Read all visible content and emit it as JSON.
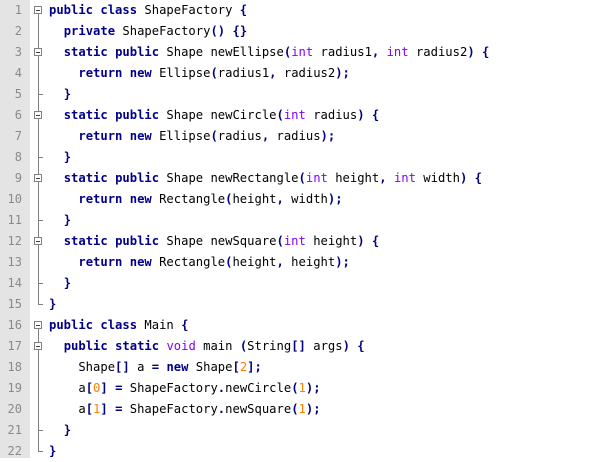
{
  "editor": {
    "lines": [
      {
        "num": "1",
        "tokens": [
          {
            "t": "public",
            "c": "kw"
          },
          {
            "t": " "
          },
          {
            "t": "class",
            "c": "kw"
          },
          {
            "t": " ShapeFactory "
          },
          {
            "t": "{",
            "c": "op"
          }
        ]
      },
      {
        "num": "2",
        "tokens": [
          {
            "t": "  "
          },
          {
            "t": "private",
            "c": "kw"
          },
          {
            "t": " ShapeFactory"
          },
          {
            "t": "()",
            "c": "op"
          },
          {
            "t": " "
          },
          {
            "t": "{}",
            "c": "op"
          }
        ]
      },
      {
        "num": "3",
        "tokens": [
          {
            "t": "  "
          },
          {
            "t": "static",
            "c": "kw"
          },
          {
            "t": " "
          },
          {
            "t": "public",
            "c": "kw"
          },
          {
            "t": " Shape newEllipse"
          },
          {
            "t": "(",
            "c": "op"
          },
          {
            "t": "int",
            "c": "ty"
          },
          {
            "t": " radius1"
          },
          {
            "t": ",",
            "c": "op"
          },
          {
            "t": " "
          },
          {
            "t": "int",
            "c": "ty"
          },
          {
            "t": " radius2"
          },
          {
            "t": ")",
            "c": "op"
          },
          {
            "t": " "
          },
          {
            "t": "{",
            "c": "op"
          }
        ]
      },
      {
        "num": "4",
        "tokens": [
          {
            "t": "    "
          },
          {
            "t": "return",
            "c": "kw"
          },
          {
            "t": " "
          },
          {
            "t": "new",
            "c": "kw"
          },
          {
            "t": " Ellipse"
          },
          {
            "t": "(",
            "c": "op"
          },
          {
            "t": "radius1"
          },
          {
            "t": ",",
            "c": "op"
          },
          {
            "t": " radius2"
          },
          {
            "t": ");",
            "c": "op"
          }
        ]
      },
      {
        "num": "5",
        "tokens": [
          {
            "t": "  "
          },
          {
            "t": "}",
            "c": "op"
          }
        ]
      },
      {
        "num": "6",
        "tokens": [
          {
            "t": "  "
          },
          {
            "t": "static",
            "c": "kw"
          },
          {
            "t": " "
          },
          {
            "t": "public",
            "c": "kw"
          },
          {
            "t": " Shape newCircle"
          },
          {
            "t": "(",
            "c": "op"
          },
          {
            "t": "int",
            "c": "ty"
          },
          {
            "t": " radius"
          },
          {
            "t": ")",
            "c": "op"
          },
          {
            "t": " "
          },
          {
            "t": "{",
            "c": "op"
          }
        ]
      },
      {
        "num": "7",
        "tokens": [
          {
            "t": "    "
          },
          {
            "t": "return",
            "c": "kw"
          },
          {
            "t": " "
          },
          {
            "t": "new",
            "c": "kw"
          },
          {
            "t": " Ellipse"
          },
          {
            "t": "(",
            "c": "op"
          },
          {
            "t": "radius"
          },
          {
            "t": ",",
            "c": "op"
          },
          {
            "t": " radius"
          },
          {
            "t": ");",
            "c": "op"
          }
        ]
      },
      {
        "num": "8",
        "tokens": [
          {
            "t": "  "
          },
          {
            "t": "}",
            "c": "op"
          }
        ]
      },
      {
        "num": "9",
        "tokens": [
          {
            "t": "  "
          },
          {
            "t": "static",
            "c": "kw"
          },
          {
            "t": " "
          },
          {
            "t": "public",
            "c": "kw"
          },
          {
            "t": " Shape newRectangle"
          },
          {
            "t": "(",
            "c": "op"
          },
          {
            "t": "int",
            "c": "ty"
          },
          {
            "t": " height"
          },
          {
            "t": ",",
            "c": "op"
          },
          {
            "t": " "
          },
          {
            "t": "int",
            "c": "ty"
          },
          {
            "t": " width"
          },
          {
            "t": ")",
            "c": "op"
          },
          {
            "t": " "
          },
          {
            "t": "{",
            "c": "op"
          }
        ]
      },
      {
        "num": "10",
        "tokens": [
          {
            "t": "    "
          },
          {
            "t": "return",
            "c": "kw"
          },
          {
            "t": " "
          },
          {
            "t": "new",
            "c": "kw"
          },
          {
            "t": " Rectangle"
          },
          {
            "t": "(",
            "c": "op"
          },
          {
            "t": "height"
          },
          {
            "t": ",",
            "c": "op"
          },
          {
            "t": " width"
          },
          {
            "t": ");",
            "c": "op"
          }
        ]
      },
      {
        "num": "11",
        "tokens": [
          {
            "t": "  "
          },
          {
            "t": "}",
            "c": "op"
          }
        ]
      },
      {
        "num": "12",
        "tokens": [
          {
            "t": "  "
          },
          {
            "t": "static",
            "c": "kw"
          },
          {
            "t": " "
          },
          {
            "t": "public",
            "c": "kw"
          },
          {
            "t": " Shape newSquare"
          },
          {
            "t": "(",
            "c": "op"
          },
          {
            "t": "int",
            "c": "ty"
          },
          {
            "t": " height"
          },
          {
            "t": ")",
            "c": "op"
          },
          {
            "t": " "
          },
          {
            "t": "{",
            "c": "op"
          }
        ]
      },
      {
        "num": "13",
        "tokens": [
          {
            "t": "    "
          },
          {
            "t": "return",
            "c": "kw"
          },
          {
            "t": " "
          },
          {
            "t": "new",
            "c": "kw"
          },
          {
            "t": " Rectangle"
          },
          {
            "t": "(",
            "c": "op"
          },
          {
            "t": "height"
          },
          {
            "t": ",",
            "c": "op"
          },
          {
            "t": " height"
          },
          {
            "t": ");",
            "c": "op"
          }
        ]
      },
      {
        "num": "14",
        "tokens": [
          {
            "t": "  "
          },
          {
            "t": "}",
            "c": "op"
          }
        ]
      },
      {
        "num": "15",
        "tokens": [
          {
            "t": "}",
            "c": "op"
          }
        ]
      },
      {
        "num": "16",
        "tokens": [
          {
            "t": "public",
            "c": "kw"
          },
          {
            "t": " "
          },
          {
            "t": "class",
            "c": "kw"
          },
          {
            "t": " Main "
          },
          {
            "t": "{",
            "c": "op"
          }
        ]
      },
      {
        "num": "17",
        "tokens": [
          {
            "t": "  "
          },
          {
            "t": "public",
            "c": "kw"
          },
          {
            "t": " "
          },
          {
            "t": "static",
            "c": "kw"
          },
          {
            "t": " "
          },
          {
            "t": "void",
            "c": "ty"
          },
          {
            "t": " main "
          },
          {
            "t": "(",
            "c": "op"
          },
          {
            "t": "String"
          },
          {
            "t": "[]",
            "c": "op"
          },
          {
            "t": " args"
          },
          {
            "t": ")",
            "c": "op"
          },
          {
            "t": " "
          },
          {
            "t": "{",
            "c": "op"
          }
        ]
      },
      {
        "num": "18",
        "tokens": [
          {
            "t": "    Shape"
          },
          {
            "t": "[]",
            "c": "op"
          },
          {
            "t": " a "
          },
          {
            "t": "=",
            "c": "op"
          },
          {
            "t": " "
          },
          {
            "t": "new",
            "c": "kw"
          },
          {
            "t": " Shape"
          },
          {
            "t": "[",
            "c": "op"
          },
          {
            "t": "2",
            "c": "nm"
          },
          {
            "t": "];",
            "c": "op"
          }
        ]
      },
      {
        "num": "19",
        "tokens": [
          {
            "t": "    a"
          },
          {
            "t": "[",
            "c": "op"
          },
          {
            "t": "0",
            "c": "nm"
          },
          {
            "t": "]",
            "c": "op"
          },
          {
            "t": " "
          },
          {
            "t": "=",
            "c": "op"
          },
          {
            "t": " ShapeFactory"
          },
          {
            "t": ".",
            "c": "op"
          },
          {
            "t": "newCircle"
          },
          {
            "t": "(",
            "c": "op"
          },
          {
            "t": "1",
            "c": "nm"
          },
          {
            "t": ");",
            "c": "op"
          }
        ]
      },
      {
        "num": "20",
        "tokens": [
          {
            "t": "    a"
          },
          {
            "t": "[",
            "c": "op"
          },
          {
            "t": "1",
            "c": "nm"
          },
          {
            "t": "]",
            "c": "op"
          },
          {
            "t": " "
          },
          {
            "t": "=",
            "c": "op"
          },
          {
            "t": " ShapeFactory"
          },
          {
            "t": ".",
            "c": "op"
          },
          {
            "t": "newSquare"
          },
          {
            "t": "(",
            "c": "op"
          },
          {
            "t": "1",
            "c": "nm"
          },
          {
            "t": ");",
            "c": "op"
          }
        ]
      },
      {
        "num": "21",
        "tokens": [
          {
            "t": "  "
          },
          {
            "t": "}",
            "c": "op"
          }
        ]
      },
      {
        "num": "22",
        "tokens": [
          {
            "t": "}",
            "c": "op"
          }
        ]
      }
    ],
    "folds": [
      {
        "start": 1,
        "end": 15
      },
      {
        "start": 3,
        "end": 5
      },
      {
        "start": 6,
        "end": 8
      },
      {
        "start": 9,
        "end": 11
      },
      {
        "start": 12,
        "end": 14
      },
      {
        "start": 16,
        "end": 22
      },
      {
        "start": 17,
        "end": 21
      }
    ],
    "colors": {
      "keyword": "#00008b",
      "type": "#8000ff",
      "operator": "#000080",
      "number": "#ff7f00",
      "gutter": "#e4e4e4",
      "line_number": "#8a8a8a"
    }
  }
}
